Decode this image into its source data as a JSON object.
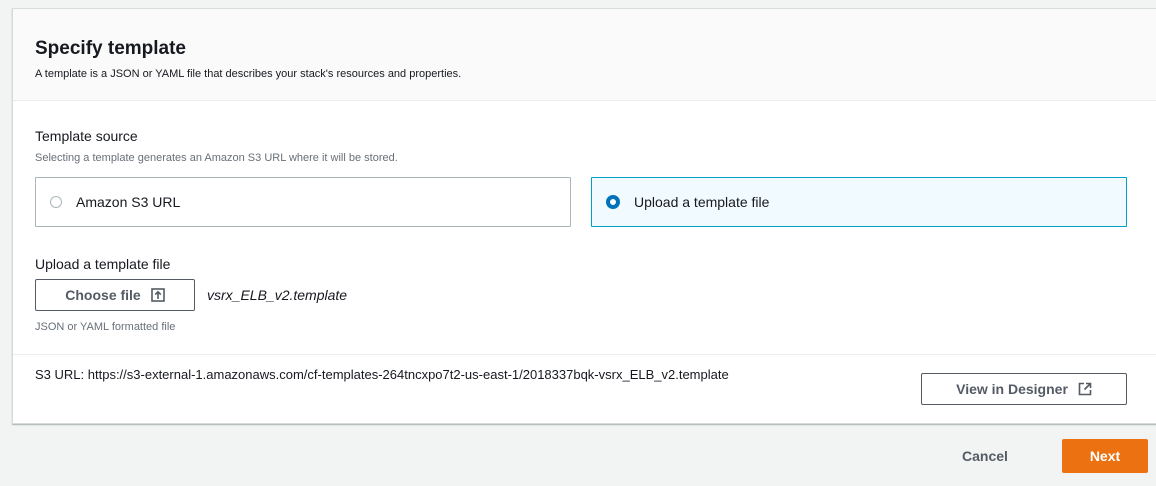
{
  "panel": {
    "title": "Specify template",
    "description": "A template is a JSON or YAML file that describes your stack's resources and properties."
  },
  "template_source": {
    "label": "Template source",
    "hint": "Selecting a template generates an Amazon S3 URL where it will be stored.",
    "options": [
      {
        "label": "Amazon S3 URL",
        "selected": false
      },
      {
        "label": "Upload a template file",
        "selected": true
      }
    ]
  },
  "upload": {
    "label": "Upload a template file",
    "choose_button": "Choose file",
    "file_name": "vsrx_ELB_v2.template",
    "hint": "JSON or YAML formatted file"
  },
  "s3": {
    "label": "S3 URL:",
    "url": "https://s3-external-1.amazonaws.com/cf-templates-264tncxpo7t2-us-east-1/2018337bqk-vsrx_ELB_v2.template",
    "designer_button": "View in Designer"
  },
  "footer": {
    "cancel_label": "Cancel",
    "next_label": "Next"
  },
  "colors": {
    "accent": "#ec7211",
    "radio_selected": "#0073bb",
    "tile_selected_border": "#00a1c9"
  },
  "icons": {
    "choose_file": "upload-icon",
    "designer": "external-link-icon"
  }
}
